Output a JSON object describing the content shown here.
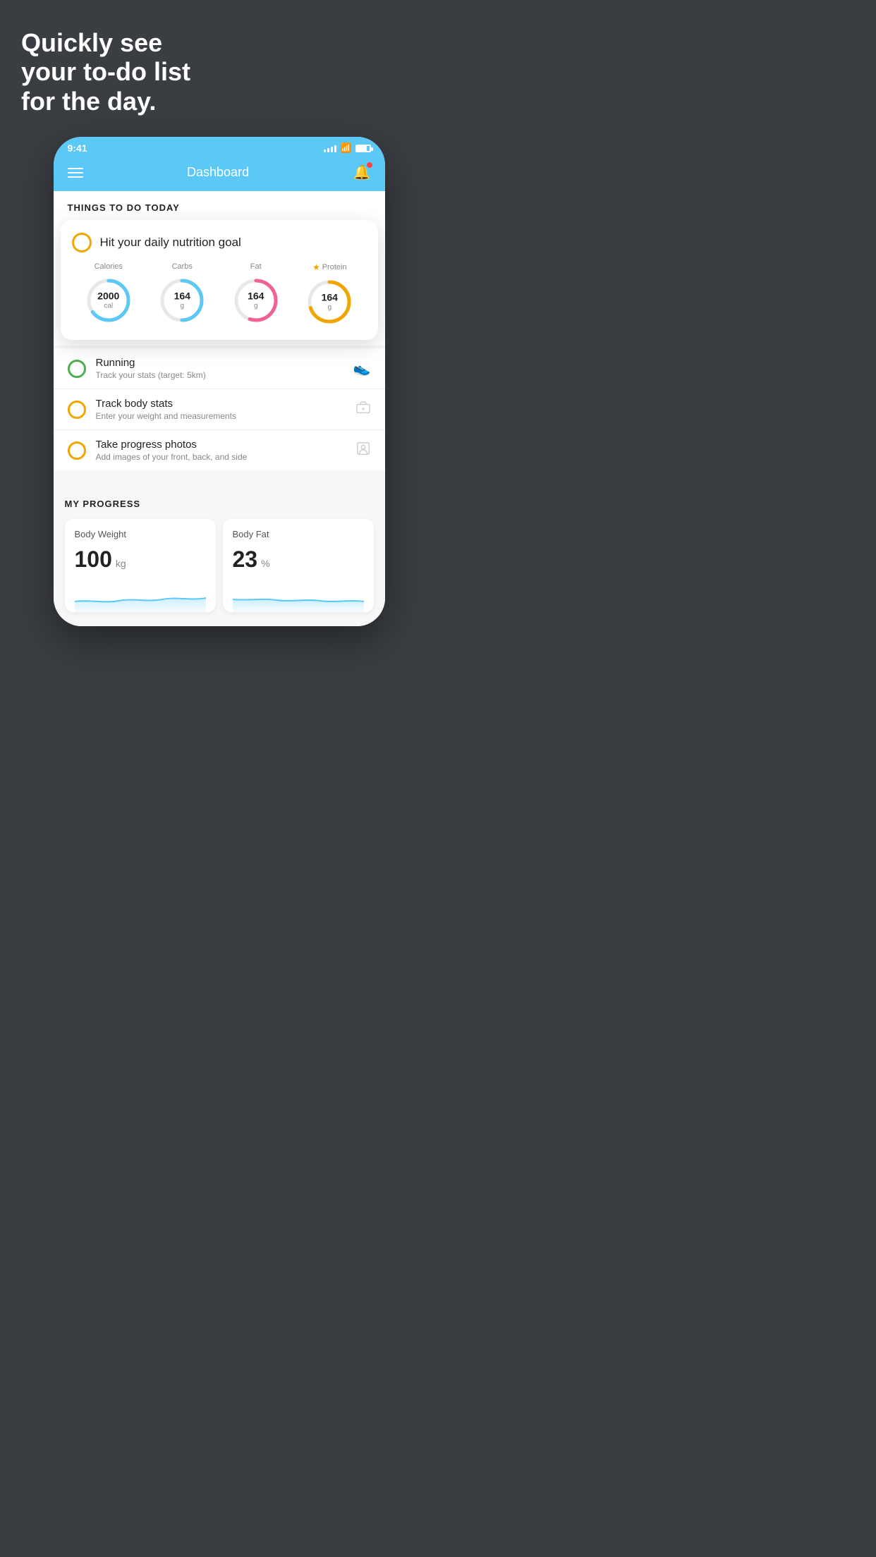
{
  "page": {
    "background_color": "#3a3d42",
    "headline": "Quickly see\nyour to-do list\nfor the day."
  },
  "status_bar": {
    "time": "9:41",
    "signal_label": "signal",
    "wifi_label": "wifi",
    "battery_label": "battery"
  },
  "app_header": {
    "title": "Dashboard",
    "menu_label": "menu",
    "bell_label": "notifications"
  },
  "things_section": {
    "title": "THINGS TO DO TODAY"
  },
  "nutrition_card": {
    "title": "Hit your daily nutrition goal",
    "macros": [
      {
        "label": "Calories",
        "value": "2000",
        "unit": "cal",
        "color": "#5bc8f5",
        "percent": 65,
        "starred": false
      },
      {
        "label": "Carbs",
        "value": "164",
        "unit": "g",
        "color": "#5bc8f5",
        "percent": 50,
        "starred": false
      },
      {
        "label": "Fat",
        "value": "164",
        "unit": "g",
        "color": "#f06292",
        "percent": 55,
        "starred": false
      },
      {
        "label": "Protein",
        "value": "164",
        "unit": "g",
        "color": "#f0a500",
        "percent": 70,
        "starred": true
      }
    ]
  },
  "todo_items": [
    {
      "name": "Running",
      "desc": "Track your stats (target: 5km)",
      "circle_color": "#4caf50",
      "icon": "🏃"
    },
    {
      "name": "Track body stats",
      "desc": "Enter your weight and measurements",
      "circle_color": "#f0a500",
      "icon": "⚖"
    },
    {
      "name": "Take progress photos",
      "desc": "Add images of your front, back, and side",
      "circle_color": "#f0a500",
      "icon": "👤"
    }
  ],
  "progress_section": {
    "title": "MY PROGRESS",
    "cards": [
      {
        "label": "Body Weight",
        "value": "100",
        "unit": "kg"
      },
      {
        "label": "Body Fat",
        "value": "23",
        "unit": "%"
      }
    ]
  }
}
